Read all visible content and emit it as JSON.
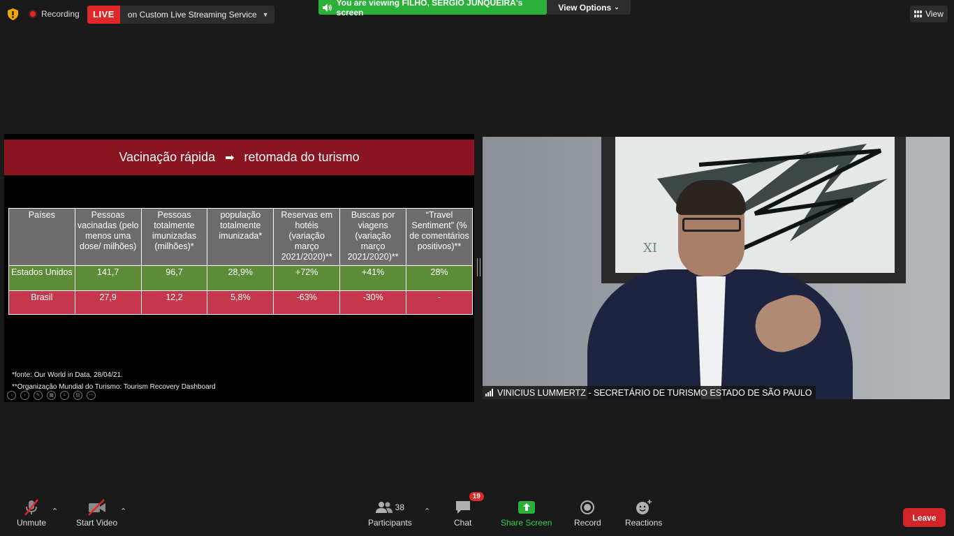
{
  "top": {
    "recording_label": "Recording",
    "live_badge": "LIVE",
    "live_service": "on Custom Live Streaming Service",
    "viewing_text": "You are viewing FILHO, SERGIO JUNQUEIRA's screen",
    "view_options": "View Options",
    "view_label": "View"
  },
  "slide": {
    "title_left": "Vacinação rápida",
    "title_right": "retomada do turismo",
    "headers": [
      "Países",
      "Pessoas vacinadas (pelo menos uma dose/ milhões)",
      "Pessoas totalmente imunizadas (milhões)*",
      "população totalmente imunizada*",
      "Reservas em hotéis (variação março 2021/2020)**",
      "Buscas por viagens (variação março 2021/2020)**",
      "“Travel Sentiment” (% de comentários positivos)**"
    ],
    "row_us": [
      "Estados Unidos",
      "141,7",
      "96,7",
      "28,9%",
      "+72%",
      "+41%",
      "28%"
    ],
    "row_br": [
      "Brasil",
      "27,9",
      "12,2",
      "5,8%",
      "-63%",
      "-30%",
      "-"
    ],
    "footnote1": "*fonte: Our World in Data, 28/04/21.",
    "footnote2": "**Organização Mundial do Turismo: Tourism Recovery Dashboard"
  },
  "video": {
    "name": "VINICIUS LUMMERTZ - SECRETÁRIO DE TURISMO ESTADO DE SÃO PAULO"
  },
  "toolbar": {
    "unmute": "Unmute",
    "start_video": "Start Video",
    "participants": "Participants",
    "participants_count": "38",
    "chat": "Chat",
    "chat_badge": "19",
    "share_screen": "Share Screen",
    "record": "Record",
    "reactions": "Reactions",
    "leave": "Leave"
  },
  "colors": {
    "live_red": "#e02828",
    "viewing_green": "#2bb13a",
    "share_green": "#2bb13a",
    "leave_red": "#d3232b",
    "slide_header": "#8b1421",
    "row_us": "#5d8c39",
    "row_br": "#c7374b",
    "row_header": "#6c6c6c"
  }
}
